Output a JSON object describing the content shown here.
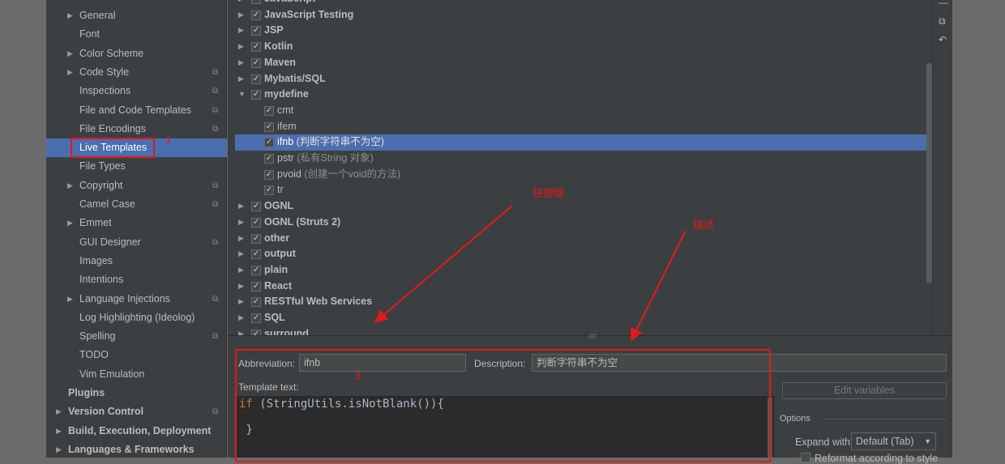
{
  "sidebar": {
    "items": [
      {
        "label": "General",
        "arrow": true,
        "copy": false
      },
      {
        "label": "Font",
        "arrow": false,
        "copy": false
      },
      {
        "label": "Color Scheme",
        "arrow": true,
        "copy": false
      },
      {
        "label": "Code Style",
        "arrow": true,
        "copy": true
      },
      {
        "label": "Inspections",
        "arrow": false,
        "copy": true
      },
      {
        "label": "File and Code Templates",
        "arrow": false,
        "copy": true
      },
      {
        "label": "File Encodings",
        "arrow": false,
        "copy": true
      },
      {
        "label": "Live Templates",
        "arrow": false,
        "copy": false,
        "selected": true
      },
      {
        "label": "File Types",
        "arrow": false,
        "copy": false
      },
      {
        "label": "Copyright",
        "arrow": true,
        "copy": true
      },
      {
        "label": "Camel Case",
        "arrow": false,
        "copy": true
      },
      {
        "label": "Emmet",
        "arrow": true,
        "copy": false
      },
      {
        "label": "GUI Designer",
        "arrow": false,
        "copy": true
      },
      {
        "label": "Images",
        "arrow": false,
        "copy": false
      },
      {
        "label": "Intentions",
        "arrow": false,
        "copy": false
      },
      {
        "label": "Language Injections",
        "arrow": true,
        "copy": true
      },
      {
        "label": "Log Highlighting (Ideolog)",
        "arrow": false,
        "copy": false
      },
      {
        "label": "Spelling",
        "arrow": false,
        "copy": true
      },
      {
        "label": "TODO",
        "arrow": false,
        "copy": false
      },
      {
        "label": "Vim Emulation",
        "arrow": false,
        "copy": false
      },
      {
        "label": "Plugins",
        "arrow": false,
        "copy": false,
        "top": true
      },
      {
        "label": "Version Control",
        "arrow": true,
        "copy": true,
        "top": true
      },
      {
        "label": "Build, Execution, Deployment",
        "arrow": true,
        "copy": false,
        "top": true
      },
      {
        "label": "Languages & Frameworks",
        "arrow": true,
        "copy": false,
        "top": true
      }
    ]
  },
  "tree": {
    "rows": [
      {
        "name": "JavaScript",
        "group": true
      },
      {
        "name": "JavaScript Testing",
        "group": true
      },
      {
        "name": "JSP",
        "group": true
      },
      {
        "name": "Kotlin",
        "group": true
      },
      {
        "name": "Maven",
        "group": true
      },
      {
        "name": "Mybatis/SQL",
        "group": true
      },
      {
        "name": "mydefine",
        "group": true,
        "expanded": true
      },
      {
        "name": "cmt",
        "desc": ""
      },
      {
        "name": "ifem",
        "desc": ""
      },
      {
        "name": "ifnb",
        "desc": "(判断字符串不为空)",
        "selected": true
      },
      {
        "name": "pstr",
        "desc": "(私有String 对象)"
      },
      {
        "name": "pvoid",
        "desc": "(创建一个void的方法)"
      },
      {
        "name": "tr",
        "desc": ""
      },
      {
        "name": "OGNL",
        "group": true
      },
      {
        "name": "OGNL (Struts 2)",
        "group": true
      },
      {
        "name": "other",
        "group": true
      },
      {
        "name": "output",
        "group": true
      },
      {
        "name": "plain",
        "group": true
      },
      {
        "name": "React",
        "group": true
      },
      {
        "name": "RESTful Web Services",
        "group": true
      },
      {
        "name": "SQL",
        "group": true
      },
      {
        "name": "surround",
        "group": true
      }
    ]
  },
  "toolbar": {
    "icons": [
      "minus-icon",
      "copy-icon",
      "undo-icon"
    ]
  },
  "editor": {
    "abbreviation_label": "Abbreviation:",
    "abbreviation_value": "ifnb",
    "description_label": "Description:",
    "description_value": "判断字符串不为空",
    "template_text_label": "Template text:",
    "code_keyword": "if",
    "code_line1": " (StringUtils.isNotBlank()){",
    "code_line3": " }",
    "edit_variables": "Edit variables",
    "options_label": "Options",
    "expand_with_label": "Expand with",
    "expand_with_value": "Default (Tab)",
    "reformat_label": "Reformat according to style"
  },
  "annotations": {
    "mark1": "1",
    "mark3": "3",
    "shortcut": "快捷键",
    "description": "描述",
    "color": "#e01b1b"
  },
  "colors": {
    "selection": "#4b6eaf",
    "panel": "#3c3f41",
    "keyword": "#cc7832"
  }
}
